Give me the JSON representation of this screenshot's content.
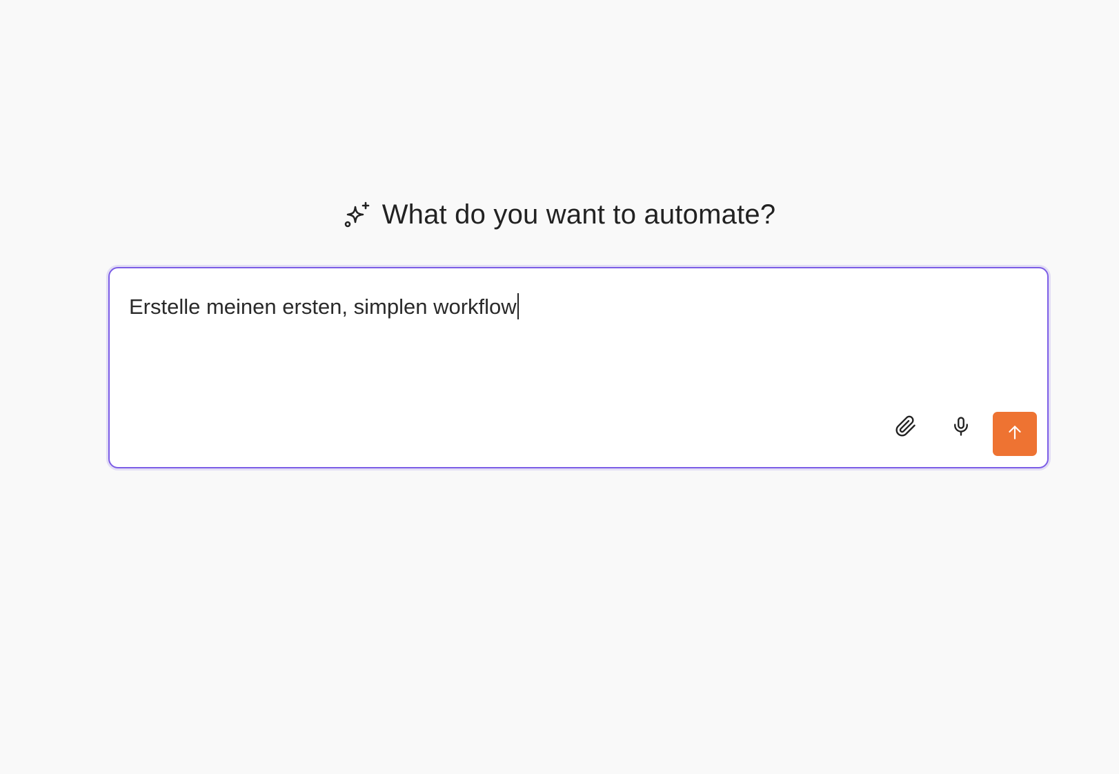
{
  "heading": {
    "icon": "sparkle-icon",
    "title": "What do you want to automate?"
  },
  "prompt": {
    "value": "Erstelle meinen ersten, simplen workflow",
    "focused": true
  },
  "actions": {
    "attach_icon": "paperclip-icon",
    "mic_icon": "microphone-icon",
    "send_icon": "arrow-up-icon"
  },
  "colors": {
    "background": "#f9f9f9",
    "focus_border": "#7b5ce6",
    "send_button": "#ee7332",
    "text": "#222222"
  }
}
